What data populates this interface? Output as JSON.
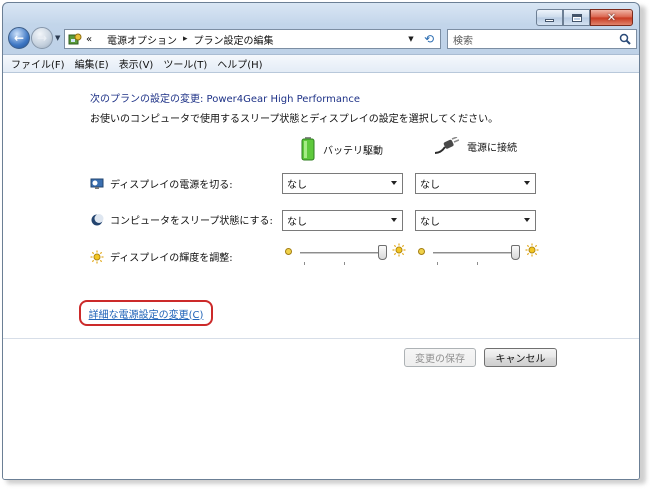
{
  "window": {
    "caption_buttons": [
      "minimize",
      "maximize",
      "close"
    ]
  },
  "nav": {
    "address": {
      "prefix": "«",
      "segments": [
        "電源オプション",
        "プラン設定の編集"
      ]
    },
    "search_placeholder": "検索"
  },
  "menu": [
    {
      "label": "ファイル(F)"
    },
    {
      "label": "編集(E)"
    },
    {
      "label": "表示(V)"
    },
    {
      "label": "ツール(T)"
    },
    {
      "label": "ヘルプ(H)"
    }
  ],
  "content": {
    "plan_title": "次のプランの設定の変更: Power4Gear High Performance",
    "plan_desc": "お使いのコンピュータで使用するスリープ状態とディスプレイの設定を選択してください。",
    "columns": {
      "battery": "バッテリ駆動",
      "ac": "電源に接続"
    },
    "rows": {
      "display_off": {
        "label": "ディスプレイの電源を切る:",
        "battery_value": "なし",
        "ac_value": "なし"
      },
      "sleep": {
        "label": "コンピュータをスリープ状態にする:",
        "battery_value": "なし",
        "ac_value": "なし"
      },
      "brightness": {
        "label": "ディスプレイの輝度を調整:",
        "battery_level_percent": 100,
        "ac_level_percent": 100
      }
    },
    "advanced_link": "詳細な電源設定の変更(C)",
    "save_button": "変更の保存",
    "cancel_button": "キャンセル"
  },
  "colors": {
    "title_blue": "#1e3287",
    "link_blue": "#1f63b8",
    "highlight_red": "#cc2a2a"
  },
  "icons": [
    "back-arrow-icon",
    "forward-arrow-icon",
    "control-panel-icon",
    "refresh-icon",
    "search-icon",
    "battery-icon",
    "ac-plug-icon",
    "display-icon",
    "sleep-moon-icon",
    "brightness-sun-icon"
  ]
}
